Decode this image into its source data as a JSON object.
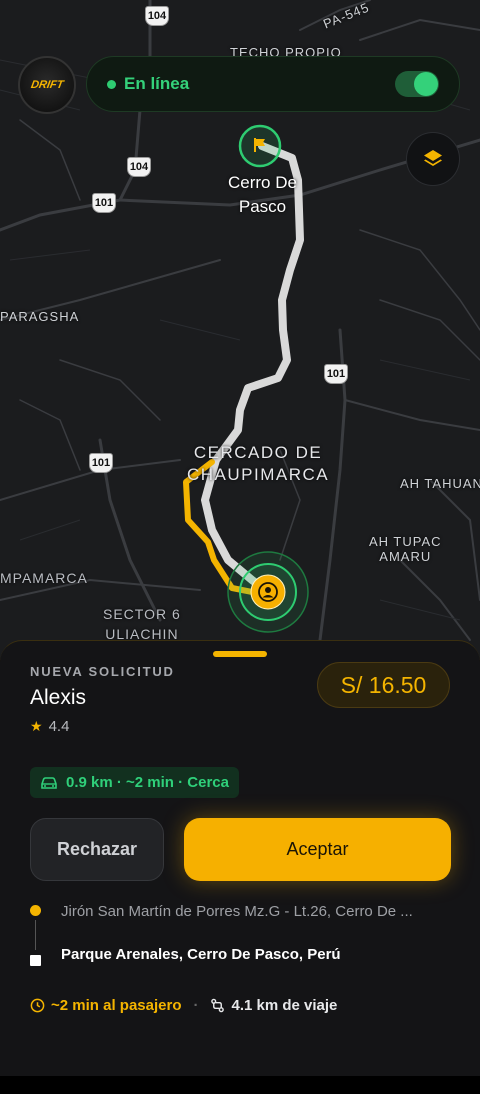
{
  "map": {
    "labels": {
      "techo_propio": "TECHO PROPIO",
      "pa545": "PA-545",
      "city": "Cerro De\nPasco",
      "paragsha": "PARAGSHA",
      "chaupimarca": "CERCADO DE\nCHAUPIMARCA",
      "ah_tahuan": "AH TAHUAN",
      "ah_tupac": "AH TUPAC\nAMARU",
      "pampamarca": "MPAMARCA",
      "sector6": "SECTOR 6\nULIACHIN"
    },
    "shields": {
      "s104_top": "104",
      "s104": "104",
      "s101_left": "101",
      "s101_right": "101",
      "s101_bottom": "101"
    }
  },
  "header": {
    "logo_text": "DRIFT",
    "status_text": "En línea",
    "toggle_on": true
  },
  "request": {
    "label": "NUEVA SOLICITUD",
    "passenger_name": "Alexis",
    "rating": "4.4",
    "price": "S/ 16.50",
    "chip_text": "0.9 km · ~2 min · Cerca",
    "reject_label": "Rechazar",
    "accept_label": "Aceptar",
    "pickup_address": "Jirón San Martín de Porres Mz.G - Lt.26, Cerro De ...",
    "dropoff_address": "Parque Arenales, Cerro De Pasco, Perú",
    "eta_text": "~2 min al pasajero",
    "trip_distance": "4.1 km de viaje"
  },
  "colors": {
    "accent": "#f6b000",
    "online": "#34d17a",
    "route_primary": "#d9d9d9",
    "route_pickup": "#f4b400"
  },
  "icons": {
    "layers": "layers-icon",
    "car": "car-icon",
    "star": "star-icon",
    "clock": "clock-icon",
    "route": "route-icon",
    "user": "user-icon",
    "flag": "flag-icon"
  }
}
